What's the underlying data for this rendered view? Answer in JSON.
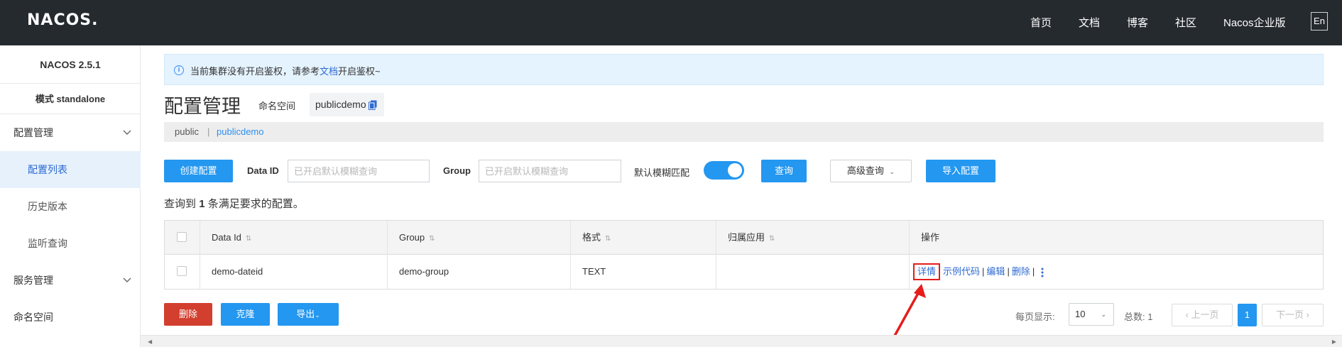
{
  "header": {
    "logo": "NACOS.",
    "nav": [
      "首页",
      "文档",
      "博客",
      "社区",
      "Nacos企业版"
    ],
    "lang": "En"
  },
  "sidebar": {
    "version": "NACOS 2.5.1",
    "mode": "模式 standalone",
    "items": [
      {
        "label": "配置管理"
      },
      {
        "label": "配置列表"
      },
      {
        "label": "历史版本"
      },
      {
        "label": "监听查询"
      },
      {
        "label": "服务管理"
      },
      {
        "label": "命名空间"
      }
    ]
  },
  "notice": {
    "prefix": "当前集群没有开启鉴权，请参考",
    "link": "文档",
    "suffix": "开启鉴权~"
  },
  "page": {
    "title": "配置管理",
    "namespace_label": "命名空间",
    "namespace_value": "publicdemo"
  },
  "ns_bar": {
    "public": "public",
    "sep": "|",
    "current": "publicdemo"
  },
  "toolbar": {
    "create": "创建配置",
    "dataid_label": "Data ID",
    "dataid_placeholder": "已开启默认模糊查询",
    "group_label": "Group",
    "group_placeholder": "已开启默认模糊查询",
    "fuzzy_label": "默认模糊匹配",
    "fuzzy_on": true,
    "query": "查询",
    "advanced": "高级查询",
    "import": "导入配置"
  },
  "result": {
    "prefix": "查询到",
    "count": "1",
    "suffix": "条满足要求的配置。"
  },
  "table": {
    "columns": [
      "Data Id",
      "Group",
      "格式",
      "归属应用",
      "操作"
    ],
    "rows": [
      {
        "data_id": "demo-dateid",
        "group": "demo-group",
        "format": "TEXT",
        "app": ""
      }
    ],
    "ops": {
      "detail": "详情",
      "sample": "示例代码",
      "edit": "编辑",
      "delete": "删除",
      "sep": "|"
    }
  },
  "bottom": {
    "delete": "删除",
    "clone": "克隆",
    "export": "导出"
  },
  "pager": {
    "per_page_label": "每页显示:",
    "per_page": "10",
    "total_label": "总数:",
    "total": "1",
    "prev": "上一页",
    "current": "1",
    "next": "下一页"
  },
  "colors": {
    "primary": "#2497f0",
    "danger": "#d23f2e",
    "topbar": "#252a2f",
    "highlight": "#e51d1d"
  }
}
